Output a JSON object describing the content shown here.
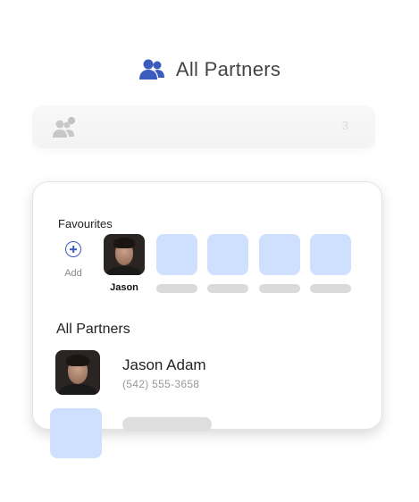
{
  "header": {
    "title": "All Partners",
    "icon": "users-icon"
  },
  "faded_bar": {
    "icon": "users-notification-icon",
    "count": "3"
  },
  "favourites": {
    "title": "Favourites",
    "add_label": "Add",
    "person_name": "Jason"
  },
  "partners": {
    "title": "All Partners",
    "items": [
      {
        "name": "Jason Adam",
        "phone": "(542) 555-3658"
      }
    ]
  },
  "colors": {
    "accent": "#3b5bbf",
    "placeholder": "#cfe0ff",
    "skeleton": "#dadada"
  }
}
